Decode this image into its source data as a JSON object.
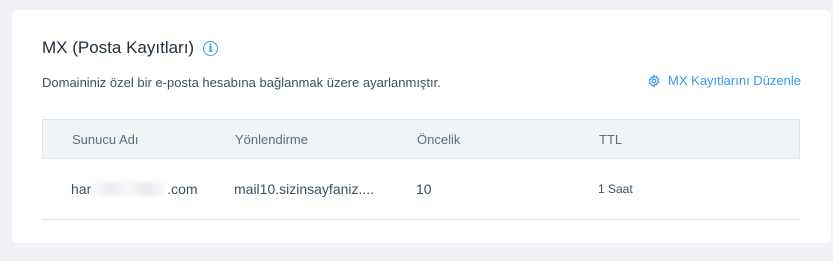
{
  "section": {
    "title": "MX (Posta Kayıtları)",
    "info_icon": "info-icon",
    "description": "Domaininiz özel bir e-posta hesabına bağlanmak üzere ayarlanmıştır.",
    "edit_label": "MX Kayıtlarını Düzenle",
    "edit_icon": "gear-icon"
  },
  "table": {
    "headers": [
      "Sunucu Adı",
      "Yönlendirme",
      "Öncelik",
      "TTL"
    ],
    "rows": [
      {
        "server": "har",
        "server_suffix": ".com",
        "target": "mail10.sizinsayfaniz....",
        "priority": "10",
        "ttl": "1 Saat"
      }
    ]
  },
  "colors": {
    "accent": "#3899ec",
    "text": "#32536a",
    "header_bg": "#f0f4f7",
    "border": "#dfe5eb"
  }
}
